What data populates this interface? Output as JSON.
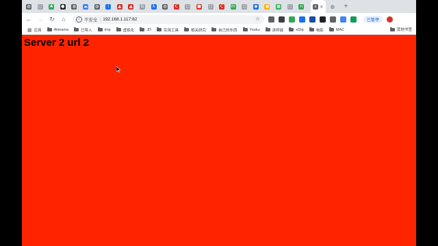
{
  "colors": {
    "page_bg": "#ff2400",
    "frame_bg": "#000000",
    "tab_strip": "#dee1e6",
    "link_blue": "#1967d2"
  },
  "tabs": [
    {
      "icon": "globe-icon",
      "color": "#5f6368",
      "glyph": "◍"
    },
    {
      "icon": "page-icon",
      "color": "#9aa0a6",
      "glyph": "▢"
    },
    {
      "icon": "leaf-icon",
      "color": "#34a853",
      "glyph": "♣"
    },
    {
      "icon": "github-icon",
      "color": "#24292e",
      "glyph": "●"
    },
    {
      "icon": "globe-icon",
      "color": "#5f6368",
      "glyph": "◍"
    },
    {
      "icon": "cloud-icon",
      "color": "#4285f4",
      "glyph": "☁"
    },
    {
      "icon": "globe-icon",
      "color": "#5f6368",
      "glyph": "◍"
    },
    {
      "icon": "info-icon",
      "color": "#1a73e8",
      "glyph": "i"
    },
    {
      "icon": "warning-icon",
      "color": "#d93025",
      "glyph": "▲"
    },
    {
      "icon": "warning-icon",
      "color": "#d93025",
      "glyph": "▲"
    },
    {
      "icon": "g-icon",
      "color": "#9aa0a6",
      "glyph": "G"
    },
    {
      "icon": "lambda-icon",
      "color": "#1a73e8",
      "glyph": "λ"
    },
    {
      "icon": "globe-icon",
      "color": "#5f6368",
      "glyph": "◍"
    },
    {
      "icon": "c-red-icon",
      "color": "#d93025",
      "glyph": "C"
    },
    {
      "icon": "page-icon",
      "color": "#9aa0a6",
      "glyph": "▢"
    },
    {
      "icon": "red-square-icon",
      "color": "#d93025",
      "glyph": "■"
    },
    {
      "icon": "page-icon",
      "color": "#9aa0a6",
      "glyph": "▢"
    },
    {
      "icon": "c-red-icon",
      "color": "#d93025",
      "glyph": "C"
    },
    {
      "icon": "m-green-icon",
      "color": "#34a853",
      "glyph": "m"
    },
    {
      "icon": "page-icon",
      "color": "#9aa0a6",
      "glyph": "▢"
    },
    {
      "icon": "diamond-blue-icon",
      "color": "#1a73e8",
      "glyph": "◆"
    },
    {
      "icon": "grid-icon",
      "color": "#f9ab00",
      "glyph": "▦"
    },
    {
      "icon": "grid-icon",
      "color": "#34a853",
      "glyph": "▦"
    },
    {
      "icon": "page-icon",
      "color": "#9aa0a6",
      "glyph": "▢"
    },
    {
      "icon": "n-green-icon",
      "color": "#34a853",
      "glyph": "n"
    }
  ],
  "active_tab": {
    "icon": "s-icon",
    "glyph": "s",
    "close": "×"
  },
  "after_tab": {
    "icon": "globe-icon",
    "glyph": "◍"
  },
  "new_tab": "+",
  "toolbar": {
    "back": "←",
    "forward": "→",
    "reload": "↻",
    "home": "⌂",
    "info_glyph": "i",
    "insecure": "不安全",
    "separator": "|",
    "url": "192.168.1.117:82",
    "star": "☆",
    "paused": "已暂停"
  },
  "extensions": [
    {
      "icon": "puzzle-icon",
      "color": "#5f6368"
    },
    {
      "icon": "ext-dark-icon",
      "color": "#3c4043"
    },
    {
      "icon": "check-icon",
      "color": "#34a853"
    },
    {
      "icon": "ext-blue-icon",
      "color": "#1a73e8"
    },
    {
      "icon": "ext-darkblue-icon",
      "color": "#174ea6"
    },
    {
      "icon": "ext-black-icon",
      "color": "#202124"
    },
    {
      "icon": "ext-gray-icon",
      "color": "#5f6368"
    },
    {
      "icon": "ext-grid-icon",
      "color": "#4285f4"
    },
    {
      "icon": "ext-green-icon",
      "color": "#0f9d58"
    }
  ],
  "bookmarks": {
    "apps": "应用",
    "items": [
      "Alimama",
      "已导入",
      "tmp",
      "虚拟化",
      "JD",
      "实用工具",
      "相关研究",
      "自己的东西",
      "Youku",
      "讲师级",
      "xl2tp",
      "电影",
      "MAC"
    ],
    "other": "其他书签"
  },
  "page": {
    "heading": "Server 2 url 2"
  }
}
